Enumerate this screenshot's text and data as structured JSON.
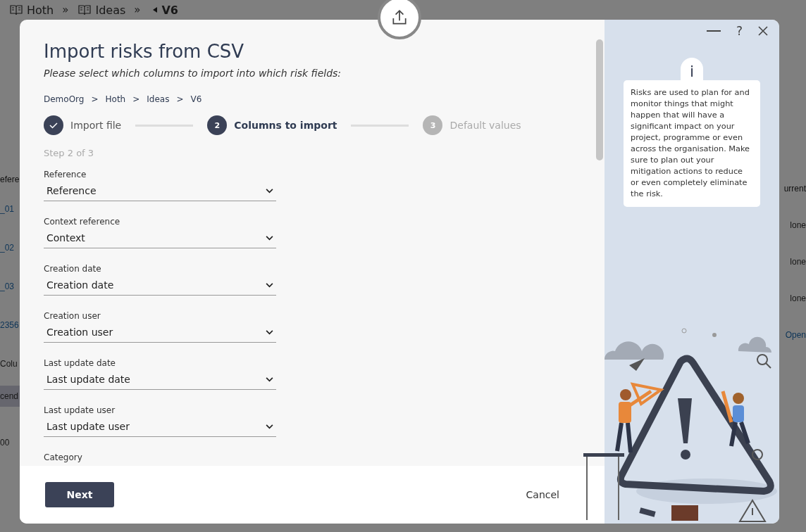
{
  "background": {
    "breadcrumb": [
      {
        "label": "Hoth",
        "kind": "book"
      },
      {
        "label": "Ideas",
        "kind": "book"
      },
      {
        "label": "V6",
        "kind": "back"
      }
    ],
    "breadcrumb_separator": "»",
    "left_fragments": [
      {
        "text": "efere",
        "kind": "header"
      },
      {
        "text": "_01",
        "kind": "link"
      },
      {
        "text": "_02",
        "kind": "link"
      },
      {
        "text": "_03",
        "kind": "link"
      },
      {
        "text": "2356",
        "kind": "link"
      },
      {
        "text": "Colu",
        "kind": "plain"
      },
      {
        "text": "cend",
        "kind": "chip"
      },
      {
        "text": "00",
        "kind": "plain"
      }
    ],
    "right_fragments": [
      {
        "text": "urrent",
        "kind": "header"
      },
      {
        "text": "lone",
        "kind": "plain"
      },
      {
        "text": "lone",
        "kind": "plain"
      },
      {
        "text": "lone",
        "kind": "plain"
      },
      {
        "text": "Open",
        "kind": "link"
      }
    ]
  },
  "dialog": {
    "title": "Import risks from CSV",
    "subtitle": "Please select which columns to import into which risk fields:",
    "path": [
      "DemoOrg",
      "Hoth",
      "Ideas",
      "V6"
    ],
    "path_separator": ">",
    "steps": [
      {
        "label": "Import file",
        "completed": true,
        "selected": false
      },
      {
        "number": "2",
        "label": "Columns to import",
        "completed": false,
        "selected": true
      },
      {
        "number": "3",
        "label": "Default values",
        "completed": false,
        "selected": false
      }
    ],
    "step_counter": "Step 2 of 3",
    "fields": [
      {
        "label": "Reference",
        "value": "Reference"
      },
      {
        "label": "Context reference",
        "value": "Context"
      },
      {
        "label": "Creation date",
        "value": "Creation date"
      },
      {
        "label": "Creation user",
        "value": "Creation user"
      },
      {
        "label": "Last update date",
        "value": "Last update date"
      },
      {
        "label": "Last update user",
        "value": "Last update user"
      },
      {
        "label": "Category"
      }
    ],
    "next_button": "Next",
    "cancel_button": "Cancel",
    "window_controls": {
      "help": "?"
    },
    "info_icon": "i",
    "info_text": "Risks are used to plan for and monitor things that might happen that will have a significant impact on your project, programme or even across the organisation. Make sure to plan out your mitigation actions to reduce or even completely eliminate the risk."
  }
}
